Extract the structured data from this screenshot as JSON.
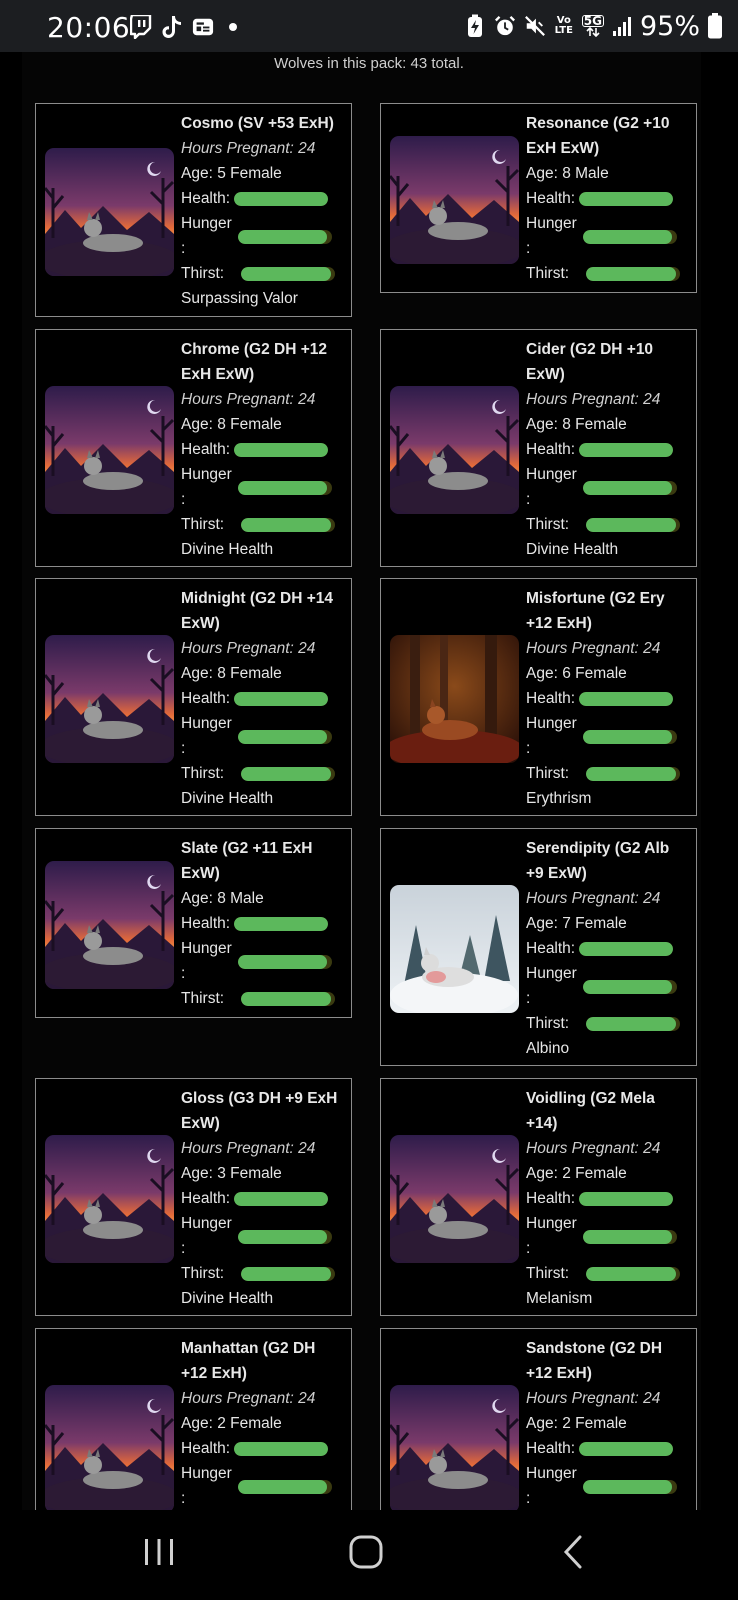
{
  "status_bar": {
    "time": "20:06",
    "left_icons": [
      "twitch-icon",
      "tiktok-icon",
      "news-icon",
      "notification-dot-icon"
    ],
    "right_icons": [
      "battery-saver-icon",
      "alarm-icon",
      "mute-icon",
      "volte-icon",
      "5g-icon",
      "signal-icon"
    ],
    "volte_label": "Vo LTE",
    "network_label": "5G",
    "battery": "95%"
  },
  "pack_count": "Wolves in this pack: 43 total.",
  "wolves": [
    {
      "name": "Cosmo (SV +53 ExH)",
      "pregnant": "Hours Pregnant: 24",
      "age": "Age: 5 Female",
      "health_label": "Health:",
      "hunger_label": "Hunger",
      "colon": ":",
      "thirst_label": "Thirst:",
      "health": 1.0,
      "hunger": 0.95,
      "thirst": 0.95,
      "trait": "Surpassing Valor",
      "image": "sunset-wolf-image"
    },
    {
      "name": "Resonance (G2 +10 ExH ExW)",
      "pregnant": "",
      "age": "Age: 8 Male",
      "health_label": "Health:",
      "hunger_label": "Hunger",
      "colon": ":",
      "thirst_label": "Thirst:",
      "health": 1.0,
      "hunger": 0.95,
      "thirst": 0.95,
      "trait": "",
      "image": "sunset-wolf-image"
    },
    {
      "name": "Chrome (G2 DH +12 ExH ExW)",
      "pregnant": "Hours Pregnant: 24",
      "age": "Age: 8 Female",
      "health_label": "Health:",
      "hunger_label": "Hunger",
      "colon": ":",
      "thirst_label": "Thirst:",
      "health": 1.0,
      "hunger": 0.95,
      "thirst": 0.95,
      "trait": "Divine Health",
      "image": "sunset-wolf-image"
    },
    {
      "name": "Cider (G2 DH +10 ExW)",
      "pregnant": "Hours Pregnant: 24",
      "age": "Age: 8 Female",
      "health_label": "Health:",
      "hunger_label": "Hunger",
      "colon": ":",
      "thirst_label": "Thirst:",
      "health": 1.0,
      "hunger": 0.95,
      "thirst": 0.95,
      "trait": "Divine Health",
      "image": "sunset-wolf-image"
    },
    {
      "name": "Midnight (G2 DH +14 ExW)",
      "pregnant": "Hours Pregnant: 24",
      "age": "Age: 8 Female",
      "health_label": "Health:",
      "hunger_label": "Hunger",
      "colon": ":",
      "thirst_label": "Thirst:",
      "health": 1.0,
      "hunger": 0.95,
      "thirst": 0.95,
      "trait": "Divine Health",
      "image": "sunset-wolf-image"
    },
    {
      "name": "Misfortune (G2 Ery +12 ExH)",
      "pregnant": "Hours Pregnant: 24",
      "age": "Age: 6 Female",
      "health_label": "Health:",
      "hunger_label": "Hunger",
      "colon": ":",
      "thirst_label": "Thirst:",
      "health": 1.0,
      "hunger": 0.95,
      "thirst": 0.95,
      "trait": "Erythrism",
      "image": "autumn-forest-wolf-image"
    },
    {
      "name": "Slate (G2 +11 ExH ExW)",
      "pregnant": "",
      "age": "Age: 8 Male",
      "health_label": "Health:",
      "hunger_label": "Hunger",
      "colon": ":",
      "thirst_label": "Thirst:",
      "health": 1.0,
      "hunger": 0.95,
      "thirst": 0.95,
      "trait": "",
      "image": "sunset-wolf-image"
    },
    {
      "name": "Serendipity (G2 Alb +9 ExW)",
      "pregnant": "Hours Pregnant: 24",
      "age": "Age: 7 Female",
      "health_label": "Health:",
      "hunger_label": "Hunger",
      "colon": ":",
      "thirst_label": "Thirst:",
      "health": 1.0,
      "hunger": 0.95,
      "thirst": 0.95,
      "trait": "Albino",
      "image": "snow-wolf-image"
    },
    {
      "name": "Gloss (G3 DH +9 ExH ExW)",
      "pregnant": "Hours Pregnant: 24",
      "age": "Age: 3 Female",
      "health_label": "Health:",
      "hunger_label": "Hunger",
      "colon": ":",
      "thirst_label": "Thirst:",
      "health": 1.0,
      "hunger": 0.95,
      "thirst": 0.95,
      "trait": "Divine Health",
      "image": "sunset-wolf-image"
    },
    {
      "name": "Voidling (G2 Mela +14)",
      "pregnant": "Hours Pregnant: 24",
      "age": "Age: 2 Female",
      "health_label": "Health:",
      "hunger_label": "Hunger",
      "colon": ":",
      "thirst_label": "Thirst:",
      "health": 1.0,
      "hunger": 0.95,
      "thirst": 0.95,
      "trait": "Melanism",
      "image": "sunset-wolf-image"
    },
    {
      "name": "Manhattan (G2 DH +12 ExH)",
      "pregnant": "Hours Pregnant: 24",
      "age": "Age: 2 Female",
      "health_label": "Health:",
      "hunger_label": "Hunger",
      "colon": ":",
      "thirst_label": "",
      "health": 1.0,
      "hunger": 0.95,
      "thirst": null,
      "trait": "",
      "image": "sunset-wolf-image"
    },
    {
      "name": "Sandstone (G2 DH +12 ExH)",
      "pregnant": "Hours Pregnant: 24",
      "age": "Age: 2 Female",
      "health_label": "Health:",
      "hunger_label": "Hunger",
      "colon": ":",
      "thirst_label": "",
      "health": 1.0,
      "hunger": 0.95,
      "thirst": null,
      "trait": "",
      "image": "sunset-wolf-image"
    }
  ],
  "nav_bar": {
    "buttons": [
      "recent-apps-icon",
      "home-icon",
      "back-icon"
    ]
  }
}
